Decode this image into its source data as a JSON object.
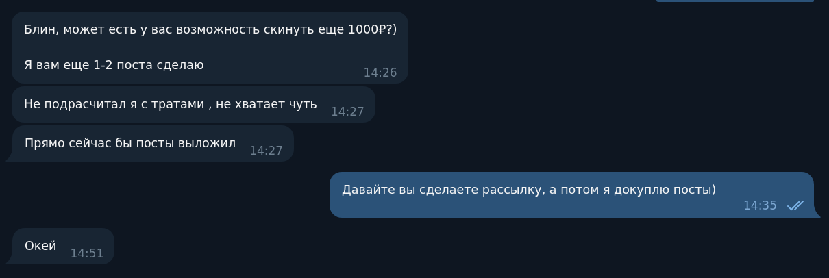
{
  "messages": [
    {
      "kind": "clipped"
    },
    {
      "kind": "incoming",
      "paragraphs": [
        "Блин, может есть у вас возможность скинуть еще 1000₽?)",
        "Я вам еще 1-2 поста сделаю"
      ],
      "time": "14:26",
      "tail": false
    },
    {
      "kind": "incoming",
      "paragraphs": [
        "Не подрасчитал я с тратами , не хватает чуть"
      ],
      "time": "14:27",
      "tail": false
    },
    {
      "kind": "incoming",
      "paragraphs": [
        "Прямо сейчас бы посты выложил"
      ],
      "time": "14:27",
      "tail": true
    },
    {
      "kind": "outgoing",
      "paragraphs": [
        "Давайте вы сделаете рассылку, а потом я докуплю посты)"
      ],
      "time": "14:35",
      "tail": true,
      "read": true
    },
    {
      "kind": "incoming",
      "paragraphs": [
        "Окей"
      ],
      "time": "14:51",
      "tail": true
    }
  ]
}
